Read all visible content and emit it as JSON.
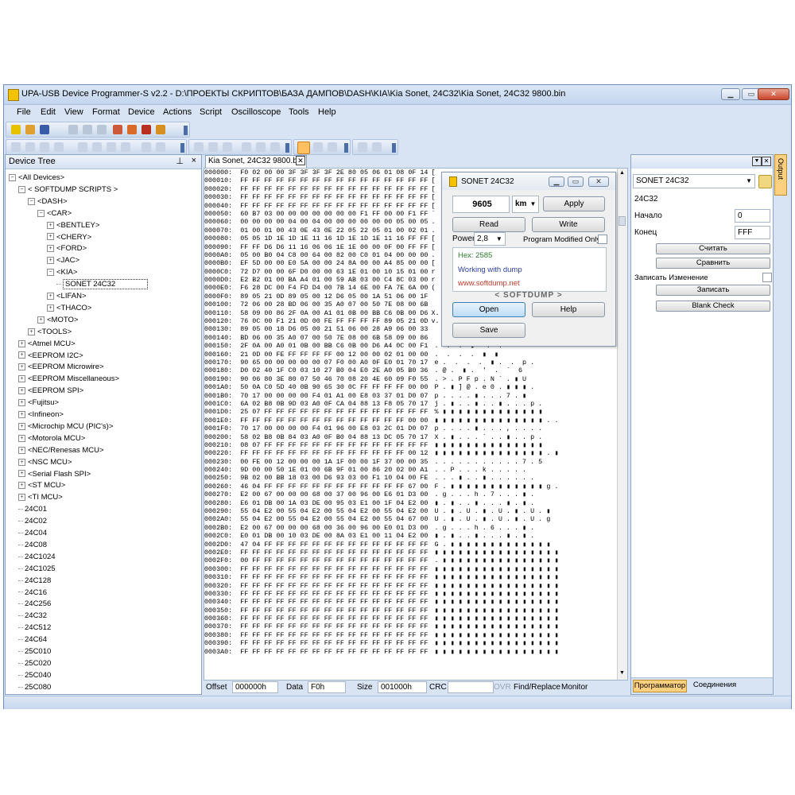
{
  "window": {
    "title": "UPA-USB Device Programmer-S v2.2 - D:\\ПРОЕКТЫ СКРИПТОВ\\БАЗА ДАМПОВ\\DASH\\KIA\\Kia Sonet, 24C32\\Kia Sonet, 24C32 9800.bin"
  },
  "menu": [
    "File",
    "Edit",
    "View",
    "Format",
    "Device",
    "Actions",
    "Script",
    "Oscilloscope",
    "Tools",
    "Help"
  ],
  "device_tree": {
    "title": "Device Tree",
    "pin": "⊥",
    "close": "×",
    "nodes": [
      {
        "label": "<All Devices>",
        "indent": 0,
        "exp": "−"
      },
      {
        "label": "< SOFTDUMP SCRIPTS >",
        "indent": 1,
        "exp": "−"
      },
      {
        "label": "<DASH>",
        "indent": 2,
        "exp": "−"
      },
      {
        "label": "<CAR>",
        "indent": 3,
        "exp": "−"
      },
      {
        "label": "<BENTLEY>",
        "indent": 4,
        "exp": "+"
      },
      {
        "label": "<CHERY>",
        "indent": 4,
        "exp": "+"
      },
      {
        "label": "<FORD>",
        "indent": 4,
        "exp": "+"
      },
      {
        "label": "<JAC>",
        "indent": 4,
        "exp": "+"
      },
      {
        "label": "<KIA>",
        "indent": 4,
        "exp": "−"
      },
      {
        "label": "SONET 24C32",
        "indent": 5,
        "exp": "",
        "selected": true
      },
      {
        "label": "<LIFAN>",
        "indent": 4,
        "exp": "+"
      },
      {
        "label": "<THACO>",
        "indent": 4,
        "exp": "+"
      },
      {
        "label": "<MOTO>",
        "indent": 3,
        "exp": "+"
      },
      {
        "label": "<TOOLS>",
        "indent": 2,
        "exp": "+"
      },
      {
        "label": "<Atmel MCU>",
        "indent": 1,
        "exp": "+"
      },
      {
        "label": "<EEPROM I2C>",
        "indent": 1,
        "exp": "+"
      },
      {
        "label": "<EEPROM Microwire>",
        "indent": 1,
        "exp": "+"
      },
      {
        "label": "<EEPROM Miscellaneous>",
        "indent": 1,
        "exp": "+"
      },
      {
        "label": "<EEPROM SPI>",
        "indent": 1,
        "exp": "+"
      },
      {
        "label": "<Fujitsu>",
        "indent": 1,
        "exp": "+"
      },
      {
        "label": "<Infineon>",
        "indent": 1,
        "exp": "+"
      },
      {
        "label": "<Microchip MCU (PIC's)>",
        "indent": 1,
        "exp": "+"
      },
      {
        "label": "<Motorola MCU>",
        "indent": 1,
        "exp": "+"
      },
      {
        "label": "<NEC/Renesas MCU>",
        "indent": 1,
        "exp": "+"
      },
      {
        "label": "<NSC MCU>",
        "indent": 1,
        "exp": "+"
      },
      {
        "label": "<Serial Flash SPI>",
        "indent": 1,
        "exp": "+"
      },
      {
        "label": "<ST MCU>",
        "indent": 1,
        "exp": "+"
      },
      {
        "label": "<TI MCU>",
        "indent": 1,
        "exp": "+"
      },
      {
        "label": "24C01",
        "indent": 1,
        "exp": ""
      },
      {
        "label": "24C02",
        "indent": 1,
        "exp": ""
      },
      {
        "label": "24C04",
        "indent": 1,
        "exp": ""
      },
      {
        "label": "24C08",
        "indent": 1,
        "exp": ""
      },
      {
        "label": "24C1024",
        "indent": 1,
        "exp": ""
      },
      {
        "label": "24C1025",
        "indent": 1,
        "exp": ""
      },
      {
        "label": "24C128",
        "indent": 1,
        "exp": ""
      },
      {
        "label": "24C16",
        "indent": 1,
        "exp": ""
      },
      {
        "label": "24C256",
        "indent": 1,
        "exp": ""
      },
      {
        "label": "24C32",
        "indent": 1,
        "exp": ""
      },
      {
        "label": "24C512",
        "indent": 1,
        "exp": ""
      },
      {
        "label": "24C64",
        "indent": 1,
        "exp": ""
      },
      {
        "label": "25C010",
        "indent": 1,
        "exp": ""
      },
      {
        "label": "25C020",
        "indent": 1,
        "exp": ""
      },
      {
        "label": "25C040",
        "indent": 1,
        "exp": ""
      },
      {
        "label": "25C080",
        "indent": 1,
        "exp": ""
      }
    ]
  },
  "editor_tab": {
    "label": "Kia Sonet, 24C32 9800.bin",
    "close": "✕"
  },
  "hex_rows": [
    "000000:  F0 02 00 00 3F 3F 3F 3F 2E 80 05 06 01 08 0F 14",
    "000010:  FF FF FF FF FF FF FF FF FF FF FF FF FF FF FF FF",
    "000020:  FF FF FF FF FF FF FF FF FF FF FF FF FF FF FF FF",
    "000030:  FF FF FF FF FF FF FF FF FF FF FF FF FF FF FF FF",
    "000040:  FF FF FF FF FF FF FF FF FF FF FF FF FF FF FF FF",
    "000050:  60 B7 03 00 00 00 00 00 00 00 F1 FF 00 00 F1 FF",
    "000060:  00 00 00 00 04 00 04 00 00 00 00 00 00 05 00 05",
    "000070:  01 00 01 00 43 0E 43 0E 22 05 22 05 01 00 02 01",
    "000080:  05 05 1D 1E 1D 1E 11 16 1D 1E 1D 1E 11 16 FF FF",
    "000090:  FF FF D6 D6 11 16 06 06 1E 1E 00 00 0F 00 FF FF",
    "0000A0:  05 00 B0 04 C8 00 64 00 82 00 C0 01 04 00 00 00",
    "0000B0:  EF 5D 00 00 E0 5A 00 00 24 8A 00 00 A4 85 00 00",
    "0000C0:  72 D7 00 00 6F D0 00 00 63 1E 01 00 10 15 01 00",
    "0000D0:  E2 B2 01 00 BA A4 01 00 59 AB 03 00 C4 8C 03 00",
    "0000E0:  F6 28 DC 00 F4 FD D4 00 7B 14 6E 00 FA 7E 6A 00",
    "0000F0:  89 05 21 0D 89 05 00 12 D6 05 00 1A 51 06 00 1F",
    "000100:  72 06 00 28 BD 06 00 35 A0 07 00 50 7E 08 00 6B",
    "000110:  58 09 00 86 2F 0A 00 A1 01 0B 00 BB C6 0B 00 D6",
    "000120:  76 0C 00 F1 21 0D 00 FE FF FF FF FF 89 05 21 0D",
    "000130:  89 05 00 18 D6 05 00 21 51 06 00 28 A9 06 00 33",
    "000140:  BD 06 00 35 A0 07 00 50 7E 08 00 6B 58 09 00 86",
    "000150:  2F 0A 00 A0 01 0B 00 BB C6 0B 00 D6 A4 0C 00 F1",
    "000160:  21 0D 00 FE FF FF FF FF 00 12 00 00 02 01 00 00",
    "000170:  90 65 00 00 00 00 00 07 F0 00 A0 0F E0 01 70 17",
    "000180:  D0 02 40 1F C0 03 10 27 B0 04 E0 2E A0 05 B0 36",
    "000190:  90 06 80 3E 80 07 50 46 70 08 20 4E 60 09 F0 55",
    "0001A0:  50 0A C0 5D 40 0B 90 65 30 0C FF FF FF FF 00 00",
    "0001B0:  70 17 00 00 00 00 F4 01 A1 00 E8 03 37 01 D0 07",
    "0001C0:  6A 02 B8 0B 9D 03 A0 0F CA 04 88 13 F8 05 70 17",
    "0001D0:  25 07 FF FF FF FF FF FF FF FF FF FF FF FF FF FF",
    "0001E0:  FF FF FF FF FF FF FF FF FF FF FF FF FF FF 00 00",
    "0001F0:  70 17 00 00 00 00 F4 01 96 00 E8 03 2C 01 D0 07",
    "000200:  58 02 B8 0B 84 03 A0 0F B0 04 88 13 DC 05 70 17",
    "000210:  08 07 FF FF FF FF FF FF FF FF FF FF FF FF FF FF",
    "000220:  FF FF FF FF FF FF FF FF FF FF FF FF FF FF 00 12",
    "000230:  00 FE 00 12 00 00 00 1A 1F 00 00 1F 37 00 00 35",
    "000240:  9D 00 00 50 1E 01 00 6B 9F 01 00 86 20 02 00 A1",
    "000250:  9B 02 00 BB 18 03 00 D6 93 03 00 F1 10 04 00 FE",
    "000260:  46 04 FF FF FF FF FF FF FF FF FF FF FF FF 67 00",
    "000270:  E2 00 67 00 00 00 68 00 37 00 96 00 E6 01 D3 00",
    "000280:  E6 01 DB 00 1A 03 DE 00 95 03 E1 00 1F 04 E2 00",
    "000290:  55 04 E2 00 55 04 E2 00 55 04 E2 00 55 04 E2 00",
    "0002A0:  55 04 E2 00 55 04 E2 00 55 04 E2 00 55 04 67 00",
    "0002B0:  E2 00 67 00 00 00 68 00 36 00 96 00 E0 01 D3 00",
    "0002C0:  E0 01 DB 00 10 03 DE 00 8A 03 E1 00 11 04 E2 00",
    "0002D0:  47 04 FF FF FF FF FF FF FF FF FF FF FF FF FF FF",
    "0002E0:  FF FF FF FF FF FF FF FF FF FF FF FF FF FF FF FF",
    "0002F0:  00 FF FF FF FF FF FF FF FF FF FF FF FF FF FF FF",
    "000300:  FF FF FF FF FF FF FF FF FF FF FF FF FF FF FF FF",
    "000310:  FF FF FF FF FF FF FF FF FF FF FF FF FF FF FF FF",
    "000320:  FF FF FF FF FF FF FF FF FF FF FF FF FF FF FF FF",
    "000330:  FF FF FF FF FF FF FF FF FF FF FF FF FF FF FF FF",
    "000340:  FF FF FF FF FF FF FF FF FF FF FF FF FF FF FF FF",
    "000350:  FF FF FF FF FF FF FF FF FF FF FF FF FF FF FF FF",
    "000360:  FF FF FF FF FF FF FF FF FF FF FF FF FF FF FF FF",
    "000370:  FF FF FF FF FF FF FF FF FF FF FF FF FF FF FF FF",
    "000380:  FF FF FF FF FF FF FF FF FF FF FF FF FF FF FF FF",
    "000390:  FF FF FF FF FF FF FF FF FF FF FF FF FF FF FF FF",
    "0003A0:  FF FF FF FF FF FF FF FF FF FF FF FF FF FF FF FF"
  ],
  "ascii_rows": [
    "[",
    "[",
    "[",
    "[",
    "[",
    "`",
    ".",
    ".",
    "[",
    "[",
    ".",
    "[",
    "r",
    "r",
    "(",
    "",
    "",
    "X.",
    "v.",
    "",
    "",
    "/",
    "!",
    ".",
    "",
    "",
    "",
    "P.",
    "p.",
    "j.",
    "%.",
    "",
    "p.",
    "X.",
    "",
    "",
    ".",
    ".",
    "",
    "F.",
    ".",
    "",
    "U.",
    "U.",
    ".",
    "",
    "G.",
    "",
    "",
    "",
    "",
    "",
    "",
    "",
    "",
    "",
    "",
    "",
    "",
    ""
  ],
  "ascii_right": [
    "",
    "",
    "",
    "",
    "",
    "",
    "",
    "",
    "",
    "",
    "",
    "",
    "",
    "",
    "",
    "",
    "",
    "",
    "",
    "",
    "",
    ".  .  .  ▮ ° .  .",
    ".  .  .  .  ▮  ▮",
    "e .  .  .  .  ▮ .  .  p .",
    ". @ .  ▮ .  '  .  `  6",
    ". > . P F p . N ` . ▮ U",
    "P . ▮ ] @ . e 0 . ▮ ▮ ▮ .",
    "p . . . . ▮ . . . 7 . ▮",
    "j . ▮ . . ▮ . . ▮ . . . p .",
    "% ▮ ▮ ▮ ▮ ▮ ▮ ▮ ▮ ▮ ▮ ▮ ▮ ▮",
    "▮ ▮ ▮ ▮ ▮ ▮ ▮ ▮ ▮ ▮ ▮ ▮ ▮ ▮ . .",
    "p . . . . ▮ . . . , . . . .",
    "X . ▮ . . . ` . . ▮ . . p .",
    "▮ ▮ ▮ ▮ ▮ ▮ ▮ ▮ ▮ ▮ ▮ ▮ ▮ ▮",
    "▮ ▮ ▮ ▮ ▮ ▮ ▮ ▮ ▮ ▮ ▮ ▮ ▮ ▮ . ▮",
    ". . . . . . . . . . . 7 . 5",
    ". . P . . . k . . . . .",
    ". . . ▮ . . ▮ . . . . . .",
    "F . ▮ ▮ ▮ ▮ ▮ ▮ ▮ ▮ ▮ ▮ ▮ ▮ g .",
    ". g . . . h . 7 . . . ▮ .",
    "▮ . ▮ . . ▮ . . . ▮ . ▮ .",
    "U . ▮ . U . ▮ . U . ▮ . U . ▮",
    "U . ▮ . U . ▮ . U . ▮ . U . g",
    ". g . . . h . 6 . . . ▮ .",
    "▮ . ▮ . . ▮ . . . ▮ . ▮ .",
    "G . ▮ ▮ ▮ ▮ ▮ ▮ ▮ ▮ ▮ ▮ ▮ ▮ ▮",
    "▮ ▮ ▮ ▮ ▮ ▮ ▮ ▮ ▮ ▮ ▮ ▮ ▮ ▮ ▮ ▮",
    ". ▮ ▮ ▮ ▮ ▮ ▮ ▮ ▮ ▮ ▮ ▮ ▮ ▮ ▮ ▮",
    "▮ ▮ ▮ ▮ ▮ ▮ ▮ ▮ ▮ ▮ ▮ ▮ ▮ ▮ ▮ ▮",
    "▮ ▮ ▮ ▮ ▮ ▮ ▮ ▮ ▮ ▮ ▮ ▮ ▮ ▮ ▮ ▮",
    "▮ ▮ ▮ ▮ ▮ ▮ ▮ ▮ ▮ ▮ ▮ ▮ ▮ ▮ ▮ ▮",
    "▮ ▮ ▮ ▮ ▮ ▮ ▮ ▮ ▮ ▮ ▮ ▮ ▮ ▮ ▮ ▮",
    "▮ ▮ ▮ ▮ ▮ ▮ ▮ ▮ ▮ ▮ ▮ ▮ ▮ ▮ ▮ ▮",
    "▮ ▮ ▮ ▮ ▮ ▮ ▮ ▮ ▮ ▮ ▮ ▮ ▮ ▮ ▮ ▮",
    "▮ ▮ ▮ ▮ ▮ ▮ ▮ ▮ ▮ ▮ ▮ ▮ ▮ ▮ ▮ ▮",
    "▮ ▮ ▮ ▮ ▮ ▮ ▮ ▮ ▮ ▮ ▮ ▮ ▮ ▮ ▮ ▮",
    "▮ ▮ ▮ ▮ ▮ ▮ ▮ ▮ ▮ ▮ ▮ ▮ ▮ ▮ ▮ ▮",
    "▮ ▮ ▮ ▮ ▮ ▮ ▮ ▮ ▮ ▮ ▮ ▮ ▮ ▮ ▮ ▮",
    "▮ ▮ ▮ ▮ ▮ ▮ ▮ ▮ ▮ ▮ ▮ ▮ ▮ ▮ ▮ ▮",
    "▮ ▮ ▮ ▮ ▮ ▮ ▮ ▮ ▮ ▮ ▮ ▮ ▮ ▮ ▮ ▮",
    "▮ ▮ ▮ ▮ ▮ ▮ ▮ ▮ ▮ ▮ ▮ ▮ ▮ ▮ ▮ ▮"
  ],
  "dialog": {
    "title": "SONET 24C32",
    "value": "9605",
    "unit": "km",
    "apply": "Apply",
    "read": "Read",
    "write": "Write",
    "power_label": "Power",
    "power_value": "2,8",
    "program_modified": "Program Modified Only",
    "hex_text": "Hex: 2585",
    "working": "Working with dump",
    "site": "www.softdump.net",
    "brand": "< SOFTDUMP >",
    "open": "Open",
    "help": "Help",
    "save": "Save"
  },
  "right_panel": {
    "device_select": "SONET 24C32",
    "device_label": "24C32",
    "start_label": "Начало",
    "start_value": "0",
    "end_label": "Конец",
    "end_value": "FFF",
    "read_btn": "Считать",
    "compare_btn": "Сравнить",
    "write_changes_label": "Записать Изменение",
    "write_btn": "Записать",
    "blank_check_btn": "Blank Check",
    "tab_programmer": "Программатор",
    "tab_connections": "Соединения",
    "output_tab": "Output"
  },
  "status": {
    "offset_label": "Offset",
    "offset_value": "000000h",
    "data_label": "Data",
    "data_value": "F0h",
    "size_label": "Size",
    "size_value": "001000h",
    "crc_label": "CRC",
    "ovr": "OVR",
    "find_replace": "Find/Replace",
    "monitor": "Monitor"
  },
  "colors": {
    "accent": "#ffd080",
    "frame": "#d8e4f3",
    "link_red": "#c0392b",
    "hex_green": "#2e7d32",
    "blue_text": "#2c3e9f"
  }
}
